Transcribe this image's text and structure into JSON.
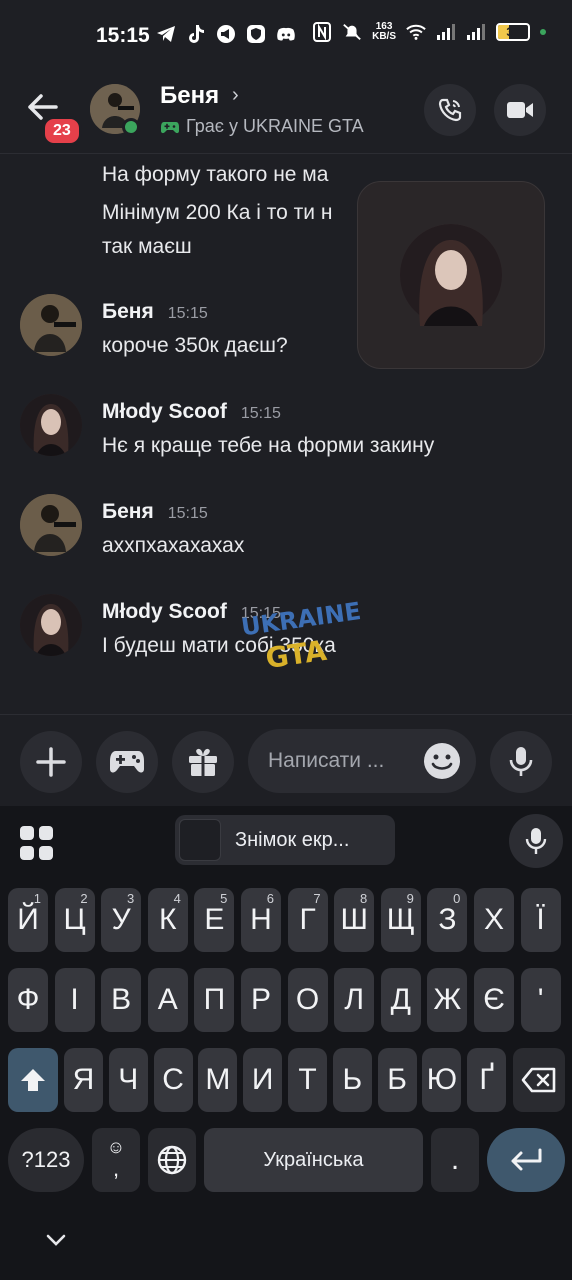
{
  "status_bar": {
    "time": "15:15",
    "net_speed_value": "163",
    "net_speed_unit": "KB/S",
    "battery": "37",
    "battery_level_percent": 37
  },
  "header": {
    "unread_count": "23",
    "contact_name": "Беня",
    "chevron": "›",
    "activity": "Грає у UKRAINE GTA"
  },
  "messages": {
    "continued": [
      "На форму такого не ма",
      "Мінімум 200 Ка і то ти н",
      "так маєш"
    ],
    "items": [
      {
        "author": "Беня",
        "time": "15:15",
        "text": "короче 350к даєш?"
      },
      {
        "author": "Młody Scoof",
        "time": "15:15",
        "text": "Нє я краще тебе на форми закину"
      },
      {
        "author": "Беня",
        "time": "15:15",
        "text": "аххпхахахахах"
      },
      {
        "author": "Młody Scoof",
        "time": "15:15",
        "text": "І будеш мати собі 350ка"
      }
    ]
  },
  "watermark": {
    "line1": "UKRAINE",
    "line2": "GTA"
  },
  "composer": {
    "placeholder": "Написати ..."
  },
  "keyboard": {
    "clipboard_label": "Знімок екр...",
    "row1": [
      {
        "k": "Й",
        "h": "1"
      },
      {
        "k": "Ц",
        "h": "2"
      },
      {
        "k": "У",
        "h": "3"
      },
      {
        "k": "К",
        "h": "4"
      },
      {
        "k": "Е",
        "h": "5"
      },
      {
        "k": "Н",
        "h": "6"
      },
      {
        "k": "Г",
        "h": "7"
      },
      {
        "k": "Ш",
        "h": "8"
      },
      {
        "k": "Щ",
        "h": "9"
      },
      {
        "k": "З",
        "h": "0"
      },
      {
        "k": "Х",
        "h": ""
      },
      {
        "k": "Ї",
        "h": ""
      }
    ],
    "row2": [
      "Ф",
      "І",
      "В",
      "А",
      "П",
      "Р",
      "О",
      "Л",
      "Д",
      "Ж",
      "Є",
      "'"
    ],
    "row3": [
      "Я",
      "Ч",
      "С",
      "М",
      "И",
      "Т",
      "Ь",
      "Б",
      "Ю",
      "Ґ"
    ],
    "symbols_label": "?123",
    "comma": ",",
    "space_label": "Українська",
    "period": "."
  },
  "colors": {
    "background": "#1e1f24",
    "online": "#3ba55d",
    "badge": "#e5404a",
    "key": "#36373d",
    "accent_key": "#3f586d",
    "battery_fill": "#f2c94c"
  },
  "icons": [
    "back-arrow-icon",
    "phone-icon",
    "video-camera-icon",
    "gamepad-icon",
    "plus-icon",
    "gift-icon",
    "emoji-icon",
    "microphone-icon",
    "keyboard-grid-icon",
    "shift-icon",
    "backspace-icon",
    "globe-icon",
    "enter-icon",
    "chevron-down-icon"
  ]
}
